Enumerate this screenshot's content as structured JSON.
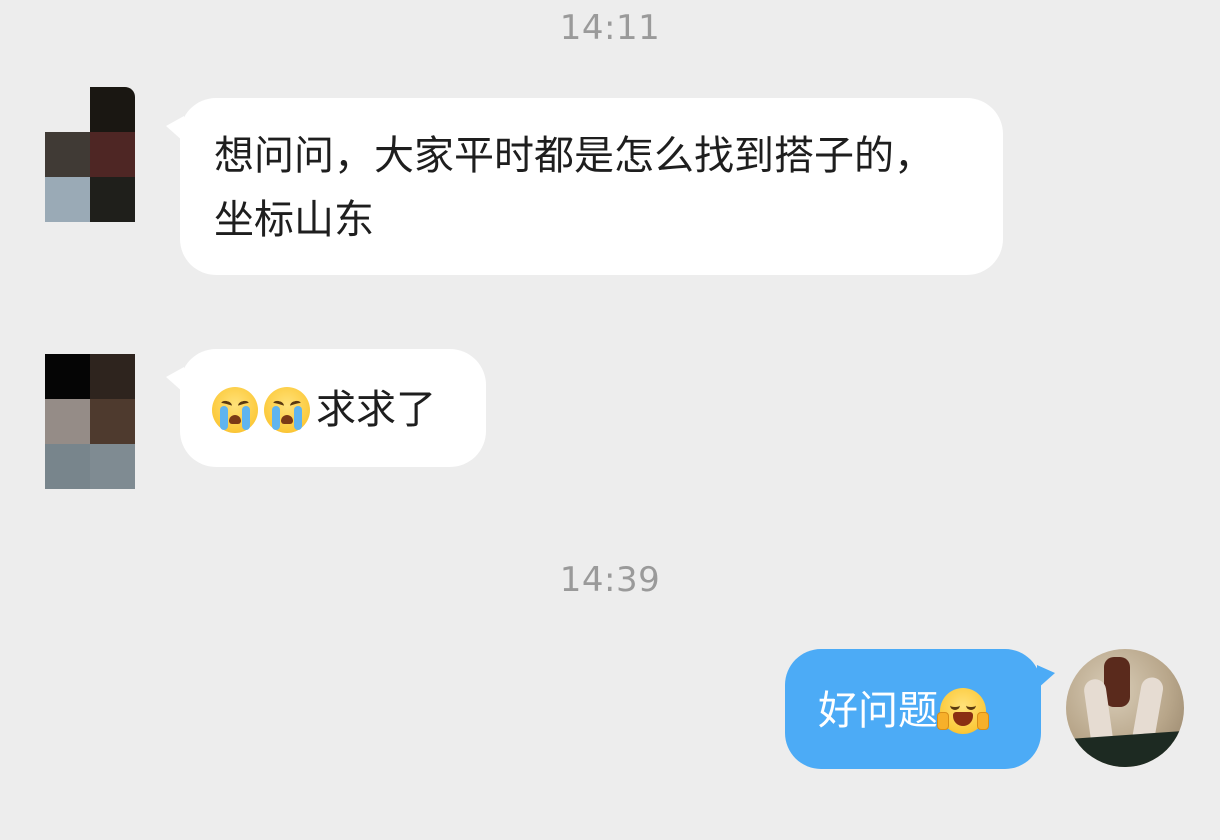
{
  "timestamps": [
    "14:11",
    "14:39"
  ],
  "messages": [
    {
      "direction": "incoming",
      "text": "想问问，大家平时都是怎么找到搭子的，坐标山东"
    },
    {
      "direction": "incoming",
      "text": "求求了",
      "emojis": [
        "loudly-crying-face",
        "loudly-crying-face"
      ]
    },
    {
      "direction": "outgoing",
      "text": "好问题",
      "emojis": [
        "screaming-joy-face"
      ]
    }
  ],
  "colors": {
    "background": "#ededed",
    "incoming_bubble": "#ffffff",
    "outgoing_bubble": "#4cabf6",
    "timestamp_text": "#9a9a9a"
  }
}
